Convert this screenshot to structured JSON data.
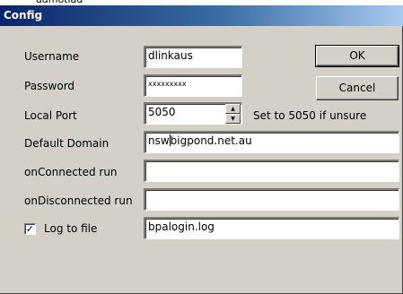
{
  "window": {
    "title": "Config",
    "top_strip_text": "admotlad"
  },
  "labels": {
    "username": "Username",
    "password": "Password",
    "local_port": "Local Port",
    "default_domain": "Default Domain",
    "on_connected": "onConnected run",
    "on_disconnected": "onDisconnected run",
    "log_to_file": "Log to file",
    "port_hint": "Set to 5050 if unsure"
  },
  "fields": {
    "username": "dlinkaus",
    "password": "xxxxxxxxx",
    "local_port": "5050",
    "default_domain_before_cursor": "nsw",
    "default_domain_after_cursor": "bigpond.net.au",
    "on_connected": "",
    "on_disconnected": "",
    "log_file": "bpalogin.log"
  },
  "checkbox": {
    "log_to_file_checked": true,
    "check_glyph": "✓"
  },
  "buttons": {
    "ok": "OK",
    "cancel": "Cancel"
  },
  "icons": {
    "spin_up": "spin-up-arrow-icon",
    "spin_down": "spin-down-arrow-icon"
  }
}
